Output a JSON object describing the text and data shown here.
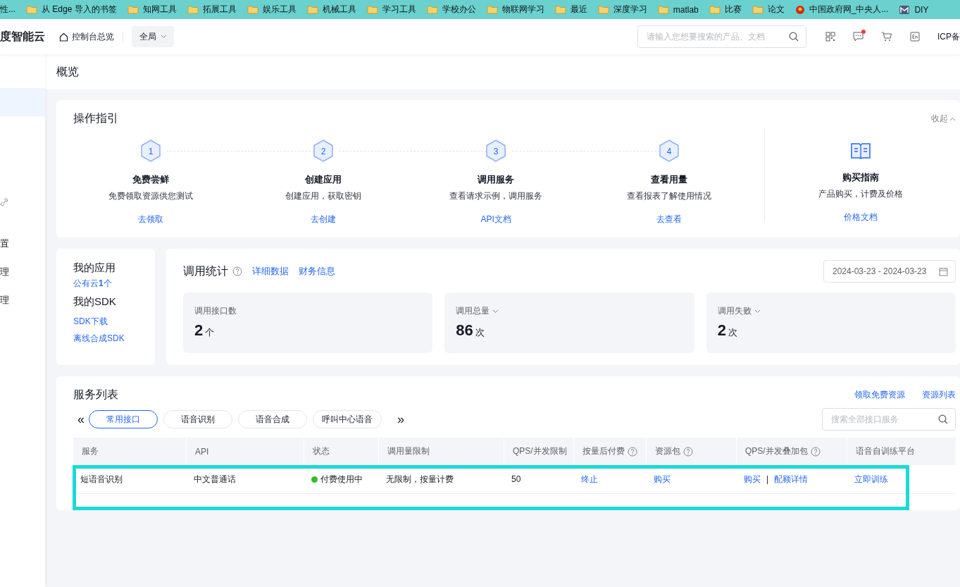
{
  "bookmarks": [
    {
      "kind": "text",
      "label": "性..."
    },
    {
      "kind": "folder",
      "label": "从 Edge 导入的书签"
    },
    {
      "kind": "folder",
      "label": "知网工具"
    },
    {
      "kind": "folder",
      "label": "拓展工具"
    },
    {
      "kind": "folder",
      "label": "娱乐工具"
    },
    {
      "kind": "folder",
      "label": "机械工具"
    },
    {
      "kind": "folder",
      "label": "学习工具"
    },
    {
      "kind": "folder",
      "label": "学校办公"
    },
    {
      "kind": "folder",
      "label": "物联网学习"
    },
    {
      "kind": "folder",
      "label": "最近"
    },
    {
      "kind": "folder",
      "label": "深度学习"
    },
    {
      "kind": "folder",
      "label": "matlab"
    },
    {
      "kind": "folder",
      "label": "比赛"
    },
    {
      "kind": "folder",
      "label": "论文"
    },
    {
      "kind": "emblem",
      "label": "中国政府网_中央人..."
    },
    {
      "kind": "app",
      "label": "DIY"
    }
  ],
  "header": {
    "logo": "度智能云",
    "console": "控制台总览",
    "region": "全局",
    "search": {
      "placeholder": "请输入您想要搜索的产品、文档"
    },
    "messages_unread": true,
    "icp": "ICP备"
  },
  "sidebar": {
    "items": [
      {
        "kind": "blank",
        "selected": true
      },
      {
        "kind": "icon",
        "selected": false
      },
      {
        "kind": "text",
        "label": "置",
        "selected": false
      },
      {
        "kind": "text",
        "label": "理",
        "selected": false
      },
      {
        "kind": "text",
        "label": "理",
        "selected": false
      }
    ]
  },
  "page_title": "概览",
  "guide": {
    "title": "操作指引",
    "collapse": "收起",
    "steps": [
      {
        "number": "1",
        "title": "免费尝鲜",
        "desc": "免费领取资源供您测试",
        "link": "去领取"
      },
      {
        "number": "2",
        "title": "创建应用",
        "desc": "创建应用，获取密钥",
        "link": "去创建"
      },
      {
        "number": "3",
        "title": "调用服务",
        "desc": "查看请求示例，调用服务",
        "link": "API文档"
      },
      {
        "number": "4",
        "title": "查看用量",
        "desc": "查看报表了解使用情况",
        "link": "去查看"
      }
    ],
    "purchase": {
      "title": "购买指南",
      "desc": "产品购买，计费及价格",
      "link": "价格文档"
    }
  },
  "my_apps": {
    "title": "我的应用",
    "link": "公有云**1**个",
    "sdk_title": "我的SDK",
    "sdk_links": [
      "SDK下载",
      "离线合成SDK"
    ]
  },
  "stats": {
    "title": "调用统计",
    "links": [
      "详细数据",
      "财务信息"
    ],
    "date_range": "2024-03-23 - 2024-03-23",
    "cards": [
      {
        "label": "调用接口数",
        "dropdown": false,
        "value": "2",
        "unit": "个"
      },
      {
        "label": "调用总量",
        "dropdown": true,
        "value": "86",
        "unit": "次"
      },
      {
        "label": "调用失败",
        "dropdown": true,
        "value": "2",
        "unit": "次"
      }
    ]
  },
  "services": {
    "title": "服务列表",
    "links": [
      "领取免费资源",
      "资源列表"
    ],
    "prev": "«",
    "next": "»",
    "tabs": [
      {
        "label": "常用接口",
        "selected": true
      },
      {
        "label": "语音识别",
        "selected": false
      },
      {
        "label": "语音合成",
        "selected": false
      },
      {
        "label": "呼叫中心语音",
        "selected": false
      }
    ],
    "search": {
      "placeholder": "搜索全部接口服务"
    },
    "columns": [
      {
        "label": "服务",
        "help": false
      },
      {
        "label": "API",
        "help": false
      },
      {
        "label": "状态",
        "help": false
      },
      {
        "label": "调用量限制",
        "help": false
      },
      {
        "label": "QPS/并发限制",
        "help": false
      },
      {
        "label": "按量后付费",
        "help": true
      },
      {
        "label": "资源包",
        "help": true
      },
      {
        "label": "QPS/并发叠加包",
        "help": true
      },
      {
        "label": "语音自训练平台",
        "help": false
      }
    ],
    "rows": [
      {
        "cells": [
          {
            "kind": "text",
            "text": "短语音识别"
          },
          {
            "kind": "text",
            "text": "中文普通话"
          },
          {
            "kind": "status",
            "text": "付费使用中",
            "color": "#2fbf24"
          },
          {
            "kind": "text",
            "text": "无限制，按量计费"
          },
          {
            "kind": "text",
            "text": "50"
          },
          {
            "kind": "link",
            "text": "终止"
          },
          {
            "kind": "link",
            "text": "购买"
          },
          {
            "kind": "links",
            "links": [
              "购买",
              "配额详情"
            ],
            "separator": "|"
          },
          {
            "kind": "link",
            "text": "立即训练"
          }
        ]
      }
    ],
    "highlighted": true
  }
}
